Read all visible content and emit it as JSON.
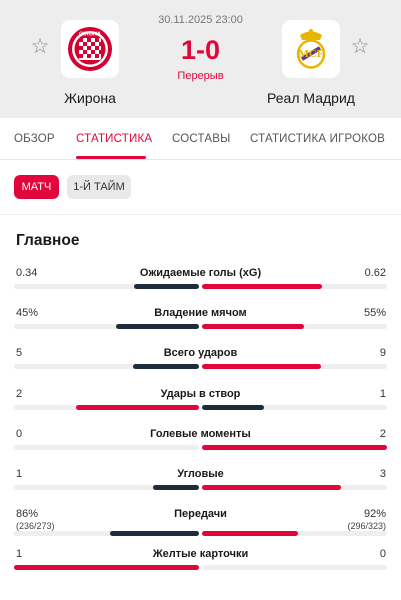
{
  "match": {
    "datetime": "30.11.2025 23:00",
    "score": "1-0",
    "status": "Перерыв",
    "home_team": {
      "name": "Жирона",
      "logo": "girona-crest",
      "logo_text": "GIRONA"
    },
    "away_team": {
      "name": "Реал Мадрид",
      "logo": "real-madrid-crest"
    }
  },
  "tabs": [
    {
      "label": "ОБЗОР",
      "active": false
    },
    {
      "label": "СТАТИСТИКА",
      "active": true
    },
    {
      "label": "СОСТАВЫ",
      "active": false
    },
    {
      "label": "СТАТИСТИКА ИГРОКОВ",
      "active": false
    }
  ],
  "period_filter": {
    "selected": "МАТЧ",
    "other": "1-Й ТАЙМ"
  },
  "section_title": "Главное",
  "colors": {
    "accent": "#e1063b",
    "home_bar": "#e1063b",
    "away_bar": "#e1063b",
    "leader_dark": "#1f2d3a",
    "track": "#eeeeee"
  },
  "stats": [
    {
      "label": "Ожидаемые голы (xG)",
      "home": "0.34",
      "away": "0.62",
      "home_share": 0.354,
      "away_share": 0.646,
      "leader": "away"
    },
    {
      "label": "Владение мячом",
      "home": "45%",
      "away": "55%",
      "home_share": 0.45,
      "away_share": 0.55,
      "leader": "away"
    },
    {
      "label": "Всего ударов",
      "home": "5",
      "away": "9",
      "home_share": 0.357,
      "away_share": 0.643,
      "leader": "away"
    },
    {
      "label": "Удары в створ",
      "home": "2",
      "away": "1",
      "home_share": 0.667,
      "away_share": 0.333,
      "leader": "home"
    },
    {
      "label": "Голевые моменты",
      "home": "0",
      "away": "2",
      "home_share": 0.0,
      "away_share": 1.0,
      "leader": "away"
    },
    {
      "label": "Угловые",
      "home": "1",
      "away": "3",
      "home_share": 0.25,
      "away_share": 0.75,
      "leader": "away"
    },
    {
      "label": "Передачи",
      "home": "86%",
      "away": "92%",
      "home_sub": "(236/273)",
      "away_sub": "(296/323)",
      "home_share": 0.48,
      "away_share": 0.52,
      "leader": "away"
    },
    {
      "label": "Желтые карточки",
      "home": "1",
      "away": "0",
      "home_share": 1.0,
      "away_share": 0.0,
      "leader": "home"
    }
  ]
}
